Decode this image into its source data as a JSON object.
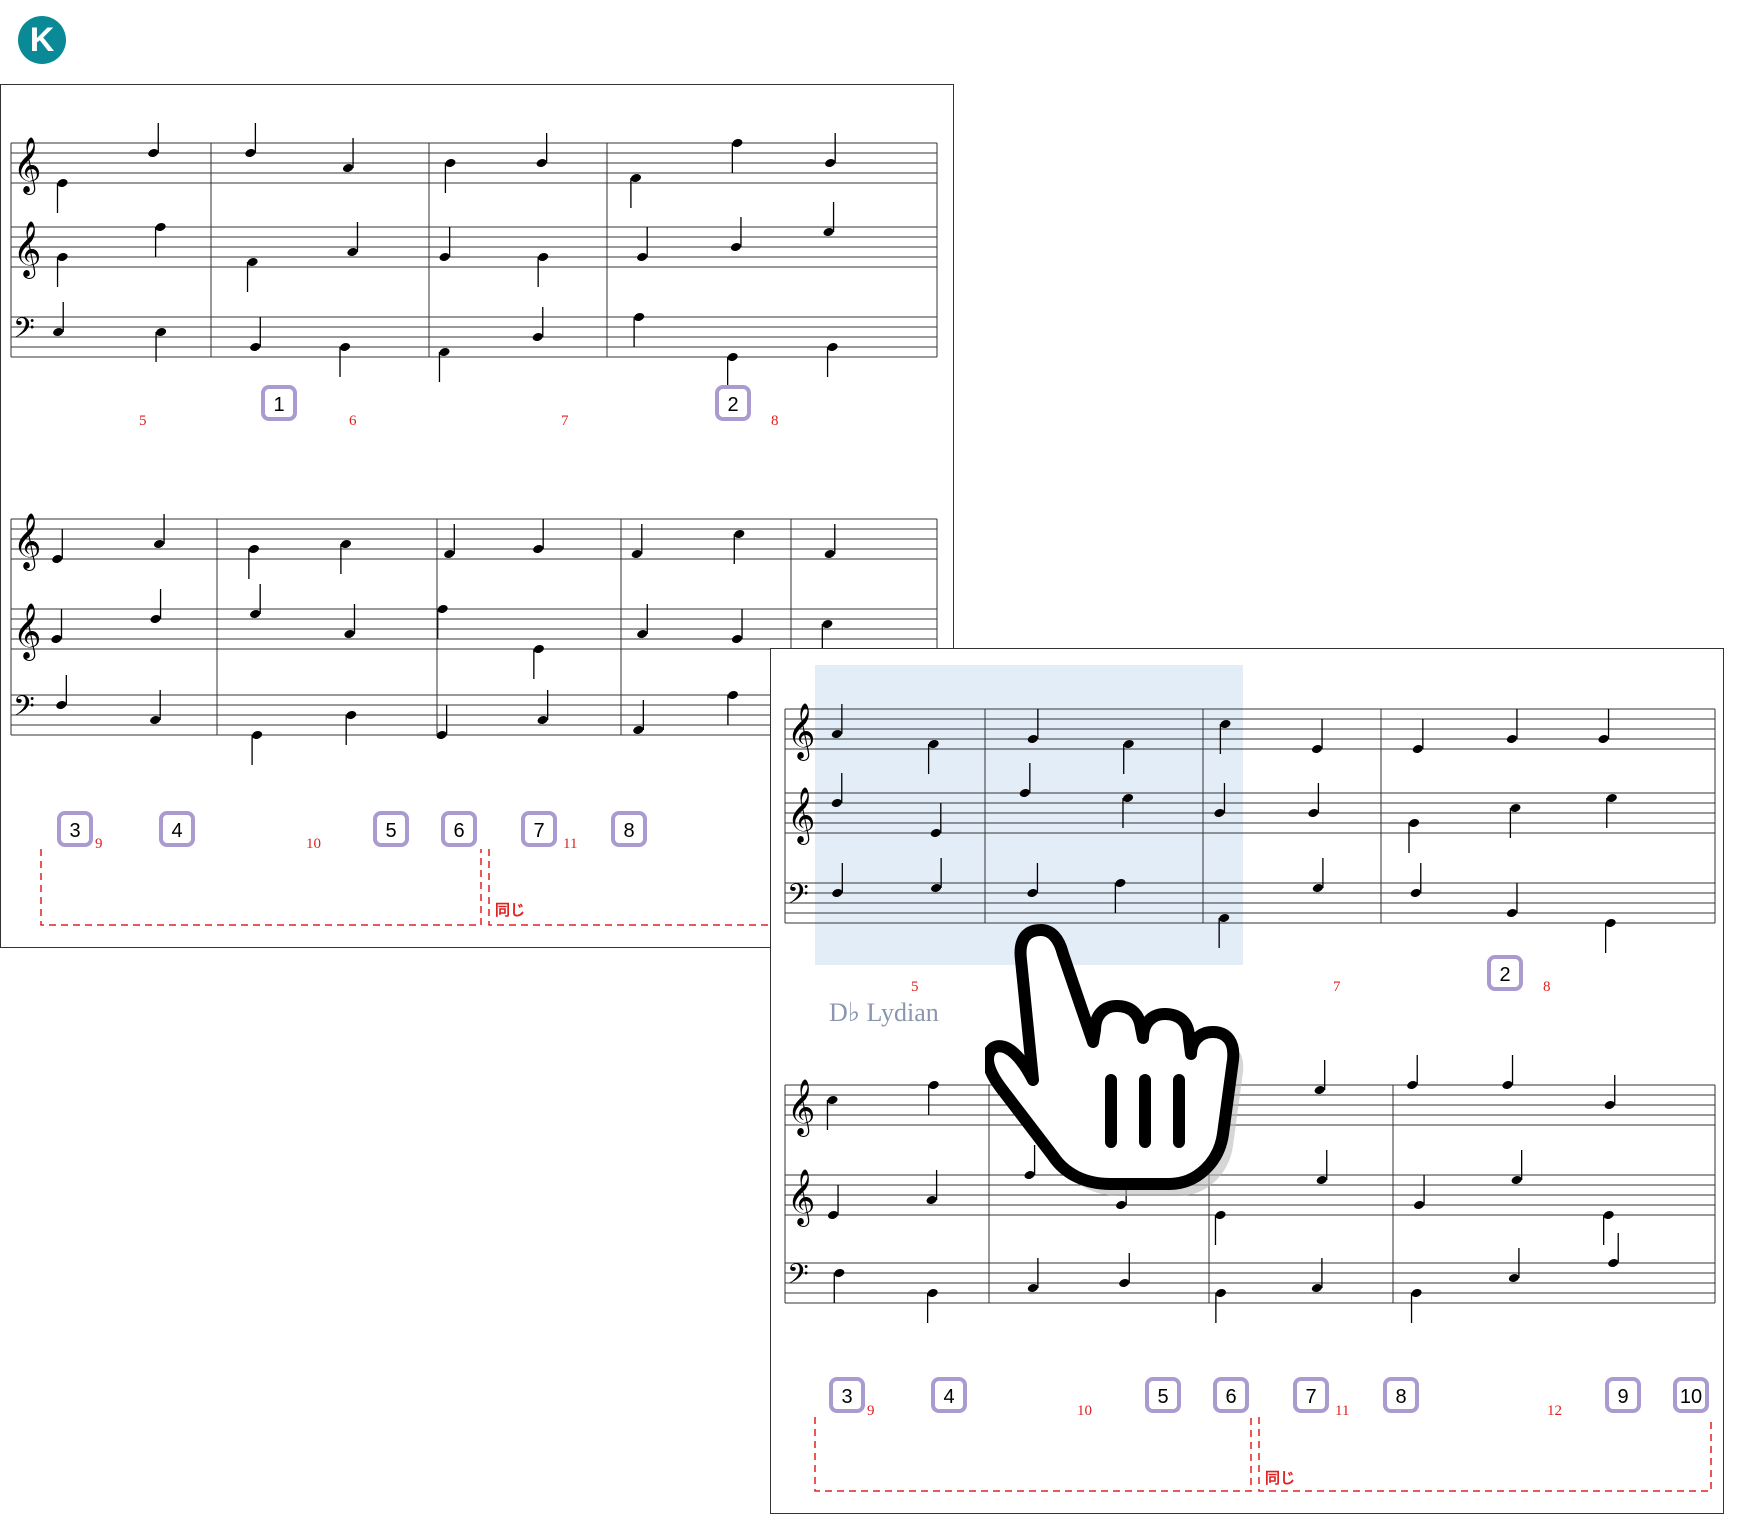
{
  "logo": {
    "letter": "K",
    "color": "#0a8a96"
  },
  "colors": {
    "measure_number": "#e0201f",
    "badge_border": "#a99bd0",
    "highlight": "#e3edf8",
    "mode_label": "#8a96b0"
  },
  "page1": {
    "system1": {
      "measure_numbers": [
        "5",
        "6",
        "7",
        "8"
      ],
      "badges": [
        "1",
        "2"
      ]
    },
    "system2": {
      "measure_numbers": [
        "9",
        "10",
        "11"
      ],
      "badges": [
        "3",
        "4",
        "5",
        "6",
        "7",
        "8"
      ],
      "same_label": "同じ"
    }
  },
  "page2": {
    "system1": {
      "measure_numbers": [
        "5",
        "7",
        "8"
      ],
      "badges": [
        "2"
      ],
      "mode_label": "D♭ Lydian"
    },
    "system2": {
      "measure_numbers": [
        "9",
        "10",
        "11",
        "12"
      ],
      "badges": [
        "3",
        "4",
        "5",
        "6",
        "7",
        "8",
        "9",
        "10"
      ],
      "same_label": "同じ"
    }
  },
  "pointer": {
    "icon": "pointing-hand-icon"
  }
}
